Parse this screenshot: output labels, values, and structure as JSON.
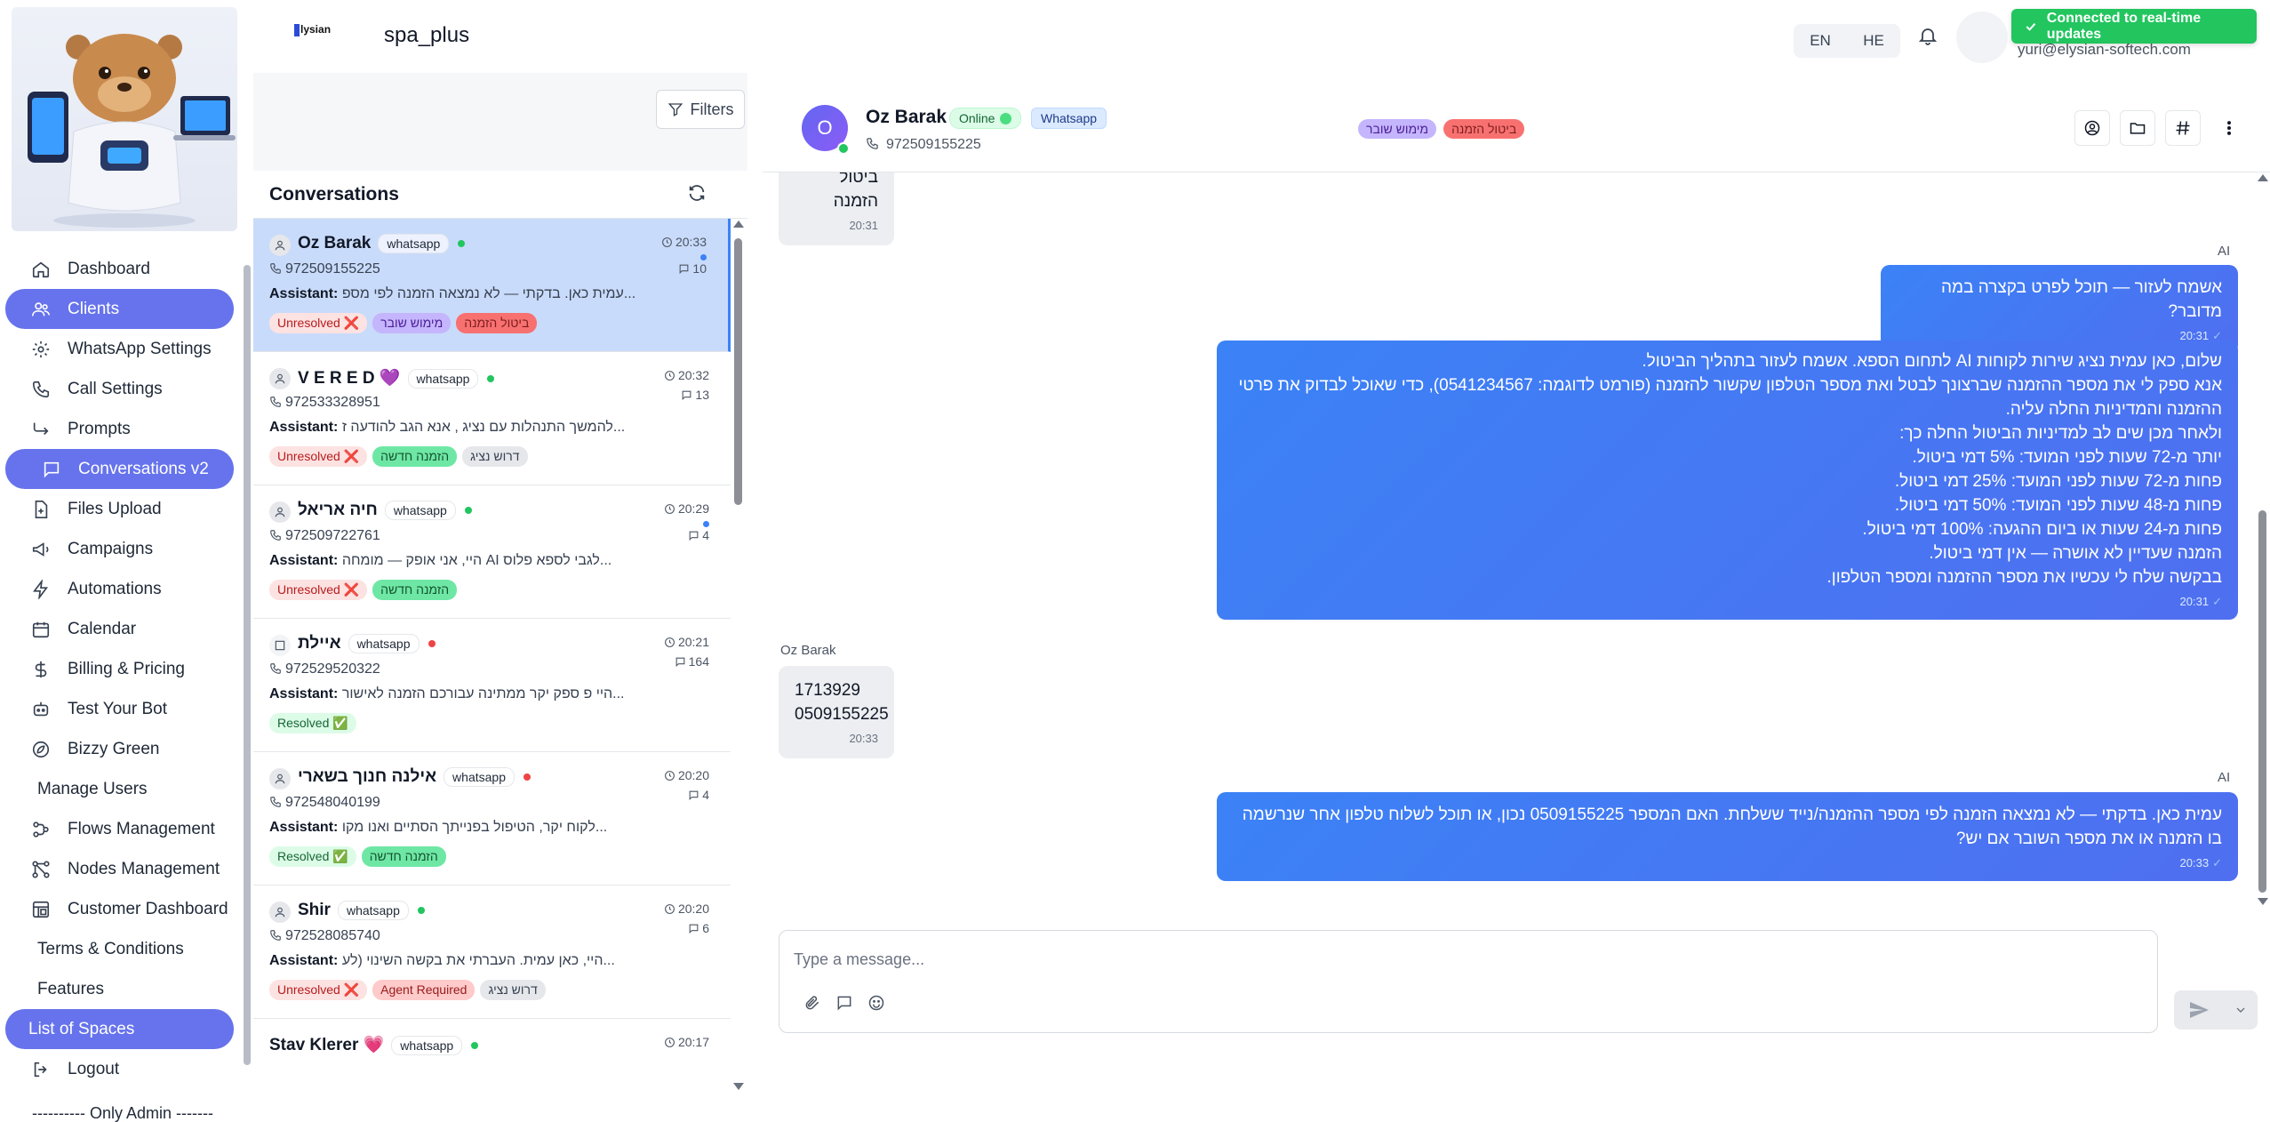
{
  "topbar": {
    "brand_text": "lysian",
    "space_name": "spa_plus",
    "lang_en": "EN",
    "lang_he": "HE",
    "user_email": "yuri@elysian-softech.com",
    "toast": "Connected to real-time updates"
  },
  "sidebar": {
    "items": [
      {
        "label": "Dashboard"
      },
      {
        "label": "Clients"
      },
      {
        "label": "WhatsApp Settings"
      },
      {
        "label": "Call Settings"
      },
      {
        "label": "Prompts"
      },
      {
        "label": "Conversations v2"
      },
      {
        "label": "Files Upload"
      },
      {
        "label": "Campaigns"
      },
      {
        "label": "Automations"
      },
      {
        "label": "Calendar"
      },
      {
        "label": "Billing & Pricing"
      },
      {
        "label": "Test Your Bot"
      },
      {
        "label": "Bizzy Green"
      },
      {
        "label": "Manage Users"
      },
      {
        "label": "Flows Management"
      },
      {
        "label": "Nodes Management"
      },
      {
        "label": "Customer Dashboard"
      },
      {
        "label": "Terms & Conditions"
      },
      {
        "label": "Features"
      },
      {
        "label": "List of Spaces"
      },
      {
        "label": "Logout"
      }
    ],
    "admin_divider": "---------- Only Admin -------"
  },
  "conversations": {
    "filters_label": "Filters",
    "title": "Conversations",
    "items": [
      {
        "name": "Oz Barak",
        "channel": "whatsapp",
        "phone": "972509155225",
        "time": "20:33",
        "count": "10",
        "sender": "Assistant:",
        "preview": "עמית כאן. בדקתי — לא נמצאה הזמנה לפי מספ...",
        "status": "Unresolved ❌",
        "tag1": "מימוש שובר",
        "tag2": "ביטול הזמנה"
      },
      {
        "name": "V E R E D 💜",
        "channel": "whatsapp",
        "phone": "972533328951",
        "time": "20:32",
        "count": "13",
        "sender": "Assistant:",
        "preview": "להמשך התנהלות עם נציג , אנא הגב להודעה ז...",
        "status": "Unresolved ❌",
        "tag1": "הזמנה חדשה",
        "tag2": "דרוש נציג"
      },
      {
        "name": "חיה אריאל",
        "channel": "whatsapp",
        "phone": "972509722761",
        "time": "20:29",
        "count": "4",
        "sender": "Assistant:",
        "preview": "היי, אני אופק — מומחה AI לגבי לספא פלוס...",
        "status": "Unresolved ❌",
        "tag1": "הזמנה חדשה"
      },
      {
        "name": "איילת",
        "channel": "whatsapp",
        "phone": "972529520322",
        "time": "20:21",
        "count": "164",
        "sender": "Assistant:",
        "preview": "היי פ ספק יקר ממתינה עבורכם הזמנה לאישור...",
        "status": "Resolved ✅"
      },
      {
        "name": "אילנה חנוך בשארי",
        "channel": "whatsapp",
        "phone": "972548040199",
        "time": "20:20",
        "count": "4",
        "sender": "Assistant:",
        "preview": "לקוח יקר, הטיפול בפנייתך הסתיים ואנו מקו...",
        "status": "Resolved ✅",
        "tag1": "הזמנה חדשה"
      },
      {
        "name": "Shir",
        "channel": "whatsapp",
        "phone": "972528085740",
        "time": "20:20",
        "count": "6",
        "sender": "Assistant:",
        "preview": "היי, כאן עמית. העברתי את בקשה השינוי (לע...",
        "status": "Unresolved ❌",
        "tag1": "Agent Required",
        "tag2": "דרוש נציג"
      },
      {
        "name": "Stav Klerer 💗",
        "channel": "whatsapp",
        "time": "20:17"
      }
    ]
  },
  "chat": {
    "avatar_letter": "O",
    "name": "Oz Barak",
    "online": "Online",
    "channel": "Whatsapp",
    "phone": "972509155225",
    "tag1": "מימוש שובר",
    "tag2": "ביטול הזמנה",
    "messages": [
      {
        "text": "ביטול הזמנה",
        "time": "20:31"
      },
      {
        "sender": "AI",
        "text": "אשמח לעזור — תוכל לפרט בקצרה במה מדובר?",
        "time": "20:31"
      },
      {
        "sender": "AI",
        "lines": [
          "שלום, כאן עמית נציג שירות לקוחות AI לתחום הספא. אשמח לעזור בתהליך הביטול.",
          "אנא ספק לי את מספר ההזמנה שברצונך לבטל ואת מספר הטלפון שקשור להזמנה (פורמט לדוגמה: 0541234567), כדי שאוכל לבדוק את פרטי ההזמנה והמדיניות החלה עליה.",
          "ולאחר מכן שים לב למדיניות הביטול החלה כך:",
          "יותר מ-72 שעות לפני המועד: 5% דמי ביטול.",
          "פחות מ-72 שעות לפני המועד: 25% דמי ביטול.",
          "פחות מ-48 שעות לפני המועד: 50% דמי ביטול.",
          "פחות מ-24 שעות או ביום ההגעה: 100% דמי ביטול.",
          "הזמנה שעדיין לא אושרה — אין דמי ביטול.",
          "בבקשה שלח לי עכשיו את מספר ההזמנה ומספר הטלפון."
        ],
        "time": "20:31"
      },
      {
        "sender": "Oz Barak",
        "line1": "1713929",
        "line2": "0509155225",
        "time": "20:33"
      },
      {
        "sender": "AI",
        "text": "עמית כאן. בדקתי — לא נמצאה הזמנה לפי מספר ההזמנה/נייד ששלחת. האם המספר 0509155225 נכון, או תוכל לשלוח טלפון אחר שנרשמה בו הזמנה או את מספר השובר אם יש?",
        "time": "20:33"
      }
    ],
    "composer_placeholder": "Type a message..."
  }
}
